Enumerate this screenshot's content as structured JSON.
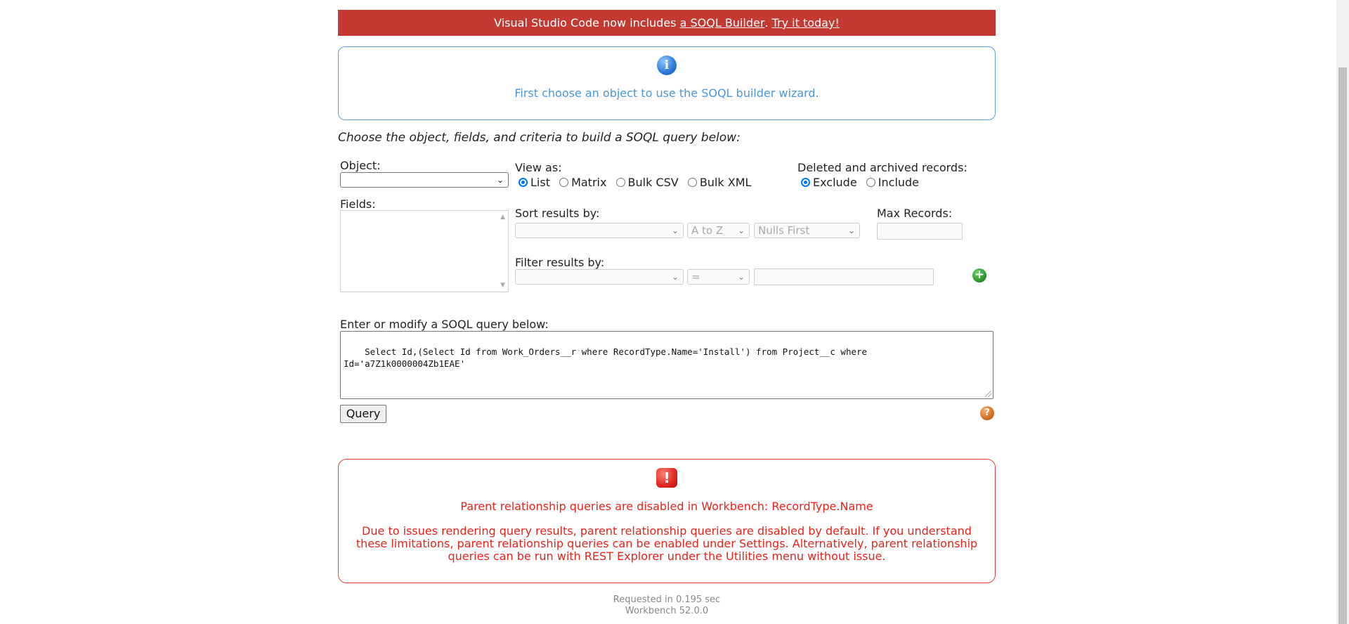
{
  "banner": {
    "prefix": "Visual Studio Code now includes ",
    "link1": "a SOQL Builder",
    "sep": ". ",
    "link2": "Try it today!"
  },
  "info": {
    "icon": "info-icon",
    "glyph": "i",
    "text": "First choose an object to use the SOQL builder wizard."
  },
  "intro": "Choose the object, fields, and criteria to build a SOQL query below:",
  "object": {
    "label": "Object:",
    "value": ""
  },
  "view_as": {
    "label": "View as:",
    "options": [
      "List",
      "Matrix",
      "Bulk CSV",
      "Bulk XML"
    ],
    "selected": "List"
  },
  "deleted": {
    "label": "Deleted and archived records:",
    "options": [
      "Exclude",
      "Include"
    ],
    "selected": "Exclude"
  },
  "fields": {
    "label": "Fields:"
  },
  "sort": {
    "label": "Sort results by:",
    "field_value": "",
    "order_value": "A to Z",
    "nulls_value": "Nulls First"
  },
  "max_records": {
    "label": "Max Records:",
    "value": ""
  },
  "filter": {
    "label": "Filter results by:",
    "field_value": "",
    "operator_value": "=",
    "value": ""
  },
  "query": {
    "label": "Enter or modify a SOQL query below:",
    "text": "Select Id,(Select Id from Work_Orders__r where RecordType.Name='Install') from Project__c where\nId='a7Z1k0000004Zb1EAE'",
    "button": "Query"
  },
  "error": {
    "glyph": "!",
    "title": "Parent relationship queries are disabled in Workbench: RecordType.Name",
    "body": "Due to issues rendering query results, parent relationship queries are disabled by default. If you understand these limitations, parent relationship queries can be enabled under Settings. Alternatively, parent relationship queries can be run with REST Explorer under the Utilities menu without issue."
  },
  "footer": {
    "requested": "Requested in 0.195 sec",
    "version": "Workbench 52.0.0"
  },
  "colors": {
    "banner": "#c43a32",
    "info": "#4a95dc",
    "error": "#e8231b",
    "radio_on": "#0075ff"
  }
}
